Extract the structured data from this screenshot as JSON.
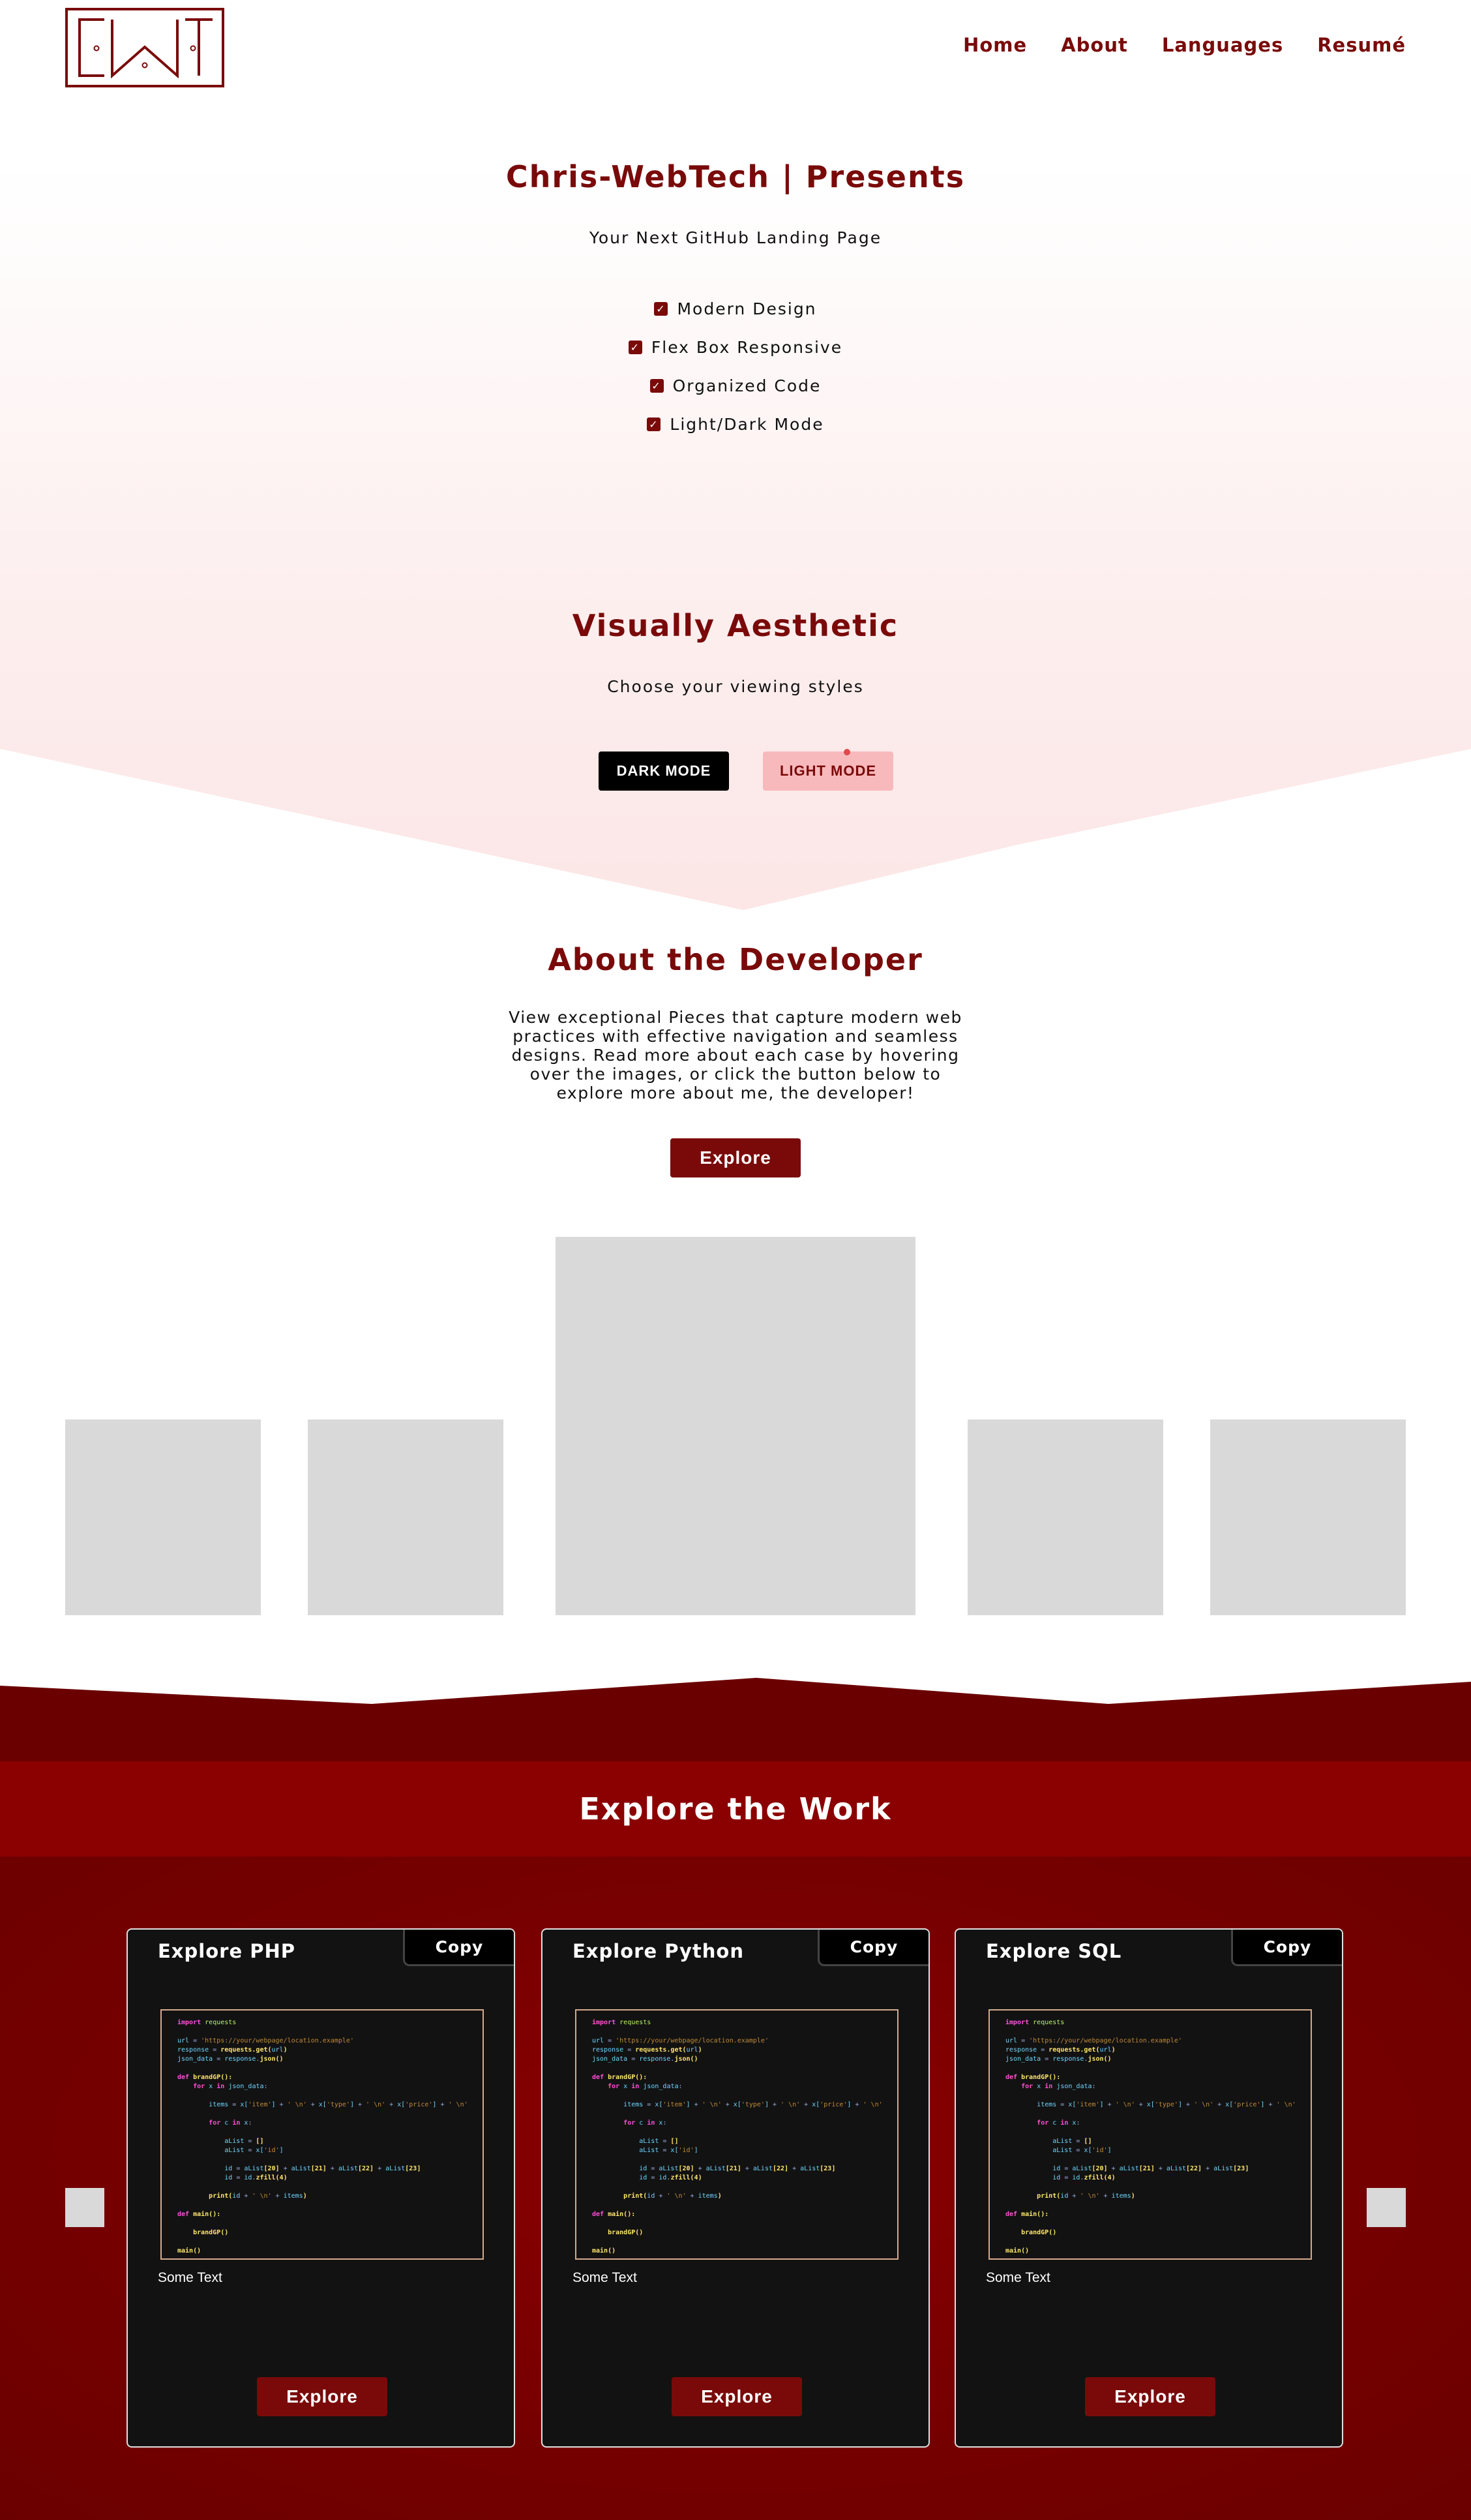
{
  "brand": {
    "logo_text": "CWT"
  },
  "nav": {
    "items": [
      "Home",
      "About",
      "Languages",
      "Resumé"
    ]
  },
  "hero": {
    "title": "Chris-WebTech | Presents",
    "subtitle": "Your Next GitHub Landing Page",
    "features": [
      "Modern Design",
      "Flex Box Responsive",
      "Organized Code",
      "Light/Dark Mode"
    ]
  },
  "aesthetic": {
    "title": "Visually Aesthetic",
    "subtitle": "Choose your viewing styles",
    "dark_label": "DARK MODE",
    "light_label": "LIGHT MODE"
  },
  "about": {
    "title": "About the Developer",
    "text": "View exceptional Pieces that capture modern web practices with effective navigation and seamless designs. Read more about each case by hovering over the images, or click the button below to explore more about me, the developer!",
    "button": "Explore"
  },
  "work": {
    "title": "Explore the Work",
    "cards": [
      {
        "title": "Explore PHP",
        "copy": "Copy",
        "text": "Some Text",
        "button": "Explore"
      },
      {
        "title": "Explore Python",
        "copy": "Copy",
        "text": "Some Text",
        "button": "Explore"
      },
      {
        "title": "Explore SQL",
        "copy": "Copy",
        "text": "Some Text",
        "button": "Explore"
      }
    ]
  },
  "colors": {
    "brand": "#7a0a0a",
    "light_mode_button": "#f8b9bc",
    "section_dark": "#6b0000",
    "section_band": "#8b0000",
    "placeholder_gray": "#d9d9d9"
  }
}
